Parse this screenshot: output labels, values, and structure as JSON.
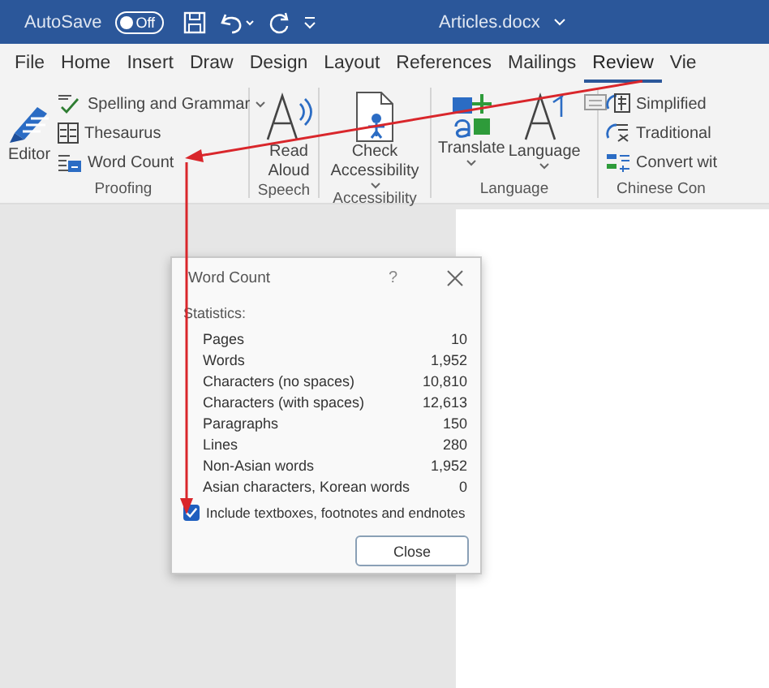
{
  "title_bar": {
    "autosave_label": "AutoSave",
    "autosave_toggle": {
      "label": "Off",
      "on": false
    },
    "document_title": "Articles.docx"
  },
  "tabs": [
    {
      "label": "File",
      "selected": false
    },
    {
      "label": "Home",
      "selected": false
    },
    {
      "label": "Insert",
      "selected": false
    },
    {
      "label": "Draw",
      "selected": false
    },
    {
      "label": "Design",
      "selected": false
    },
    {
      "label": "Layout",
      "selected": false
    },
    {
      "label": "References",
      "selected": false
    },
    {
      "label": "Mailings",
      "selected": false
    },
    {
      "label": "Review",
      "selected": true
    },
    {
      "label": "Vie",
      "selected": false
    }
  ],
  "ribbon": {
    "groups": [
      {
        "label": "Proofing",
        "items": [
          {
            "kind": "large",
            "label": "Editor",
            "dropdown": false
          },
          {
            "kind": "small",
            "label": "Spelling and Grammar",
            "dropdown": true
          },
          {
            "kind": "small",
            "label": "Thesaurus",
            "dropdown": false
          },
          {
            "kind": "small",
            "label": "Word Count",
            "dropdown": false
          }
        ]
      },
      {
        "label": "Speech",
        "items": [
          {
            "kind": "large",
            "label": "Read Aloud",
            "dropdown": false
          }
        ]
      },
      {
        "label": "Accessibility",
        "items": [
          {
            "kind": "large",
            "label": "Check Accessibility",
            "dropdown": true
          }
        ]
      },
      {
        "label": "Language",
        "items": [
          {
            "kind": "large",
            "label": "Translate",
            "dropdown": true
          },
          {
            "kind": "large",
            "label": "Language",
            "dropdown": true
          },
          {
            "kind": "mini",
            "dropdown": false
          }
        ]
      },
      {
        "label": "Chinese Con",
        "items": [
          {
            "kind": "small",
            "label": "Simplified",
            "dropdown": false
          },
          {
            "kind": "small",
            "label": "Traditional",
            "dropdown": false
          },
          {
            "kind": "small",
            "label": "Convert wit",
            "dropdown": false
          }
        ]
      }
    ]
  },
  "dialog": {
    "title": "Word Count",
    "help": "?",
    "section_label": "Statistics:",
    "stats": [
      {
        "label": "Pages",
        "value": "10"
      },
      {
        "label": "Words",
        "value": "1,952"
      },
      {
        "label": "Characters (no spaces)",
        "value": "10,810"
      },
      {
        "label": "Characters (with spaces)",
        "value": "12,613"
      },
      {
        "label": "Paragraphs",
        "value": "150"
      },
      {
        "label": "Lines",
        "value": "280"
      },
      {
        "label": "Non-Asian words",
        "value": "1,952"
      },
      {
        "label": "Asian characters, Korean words",
        "value": "0"
      }
    ],
    "include_checkbox": {
      "label": "Include textboxes, footnotes and endnotes",
      "checked": true
    },
    "close_button": "Close"
  }
}
